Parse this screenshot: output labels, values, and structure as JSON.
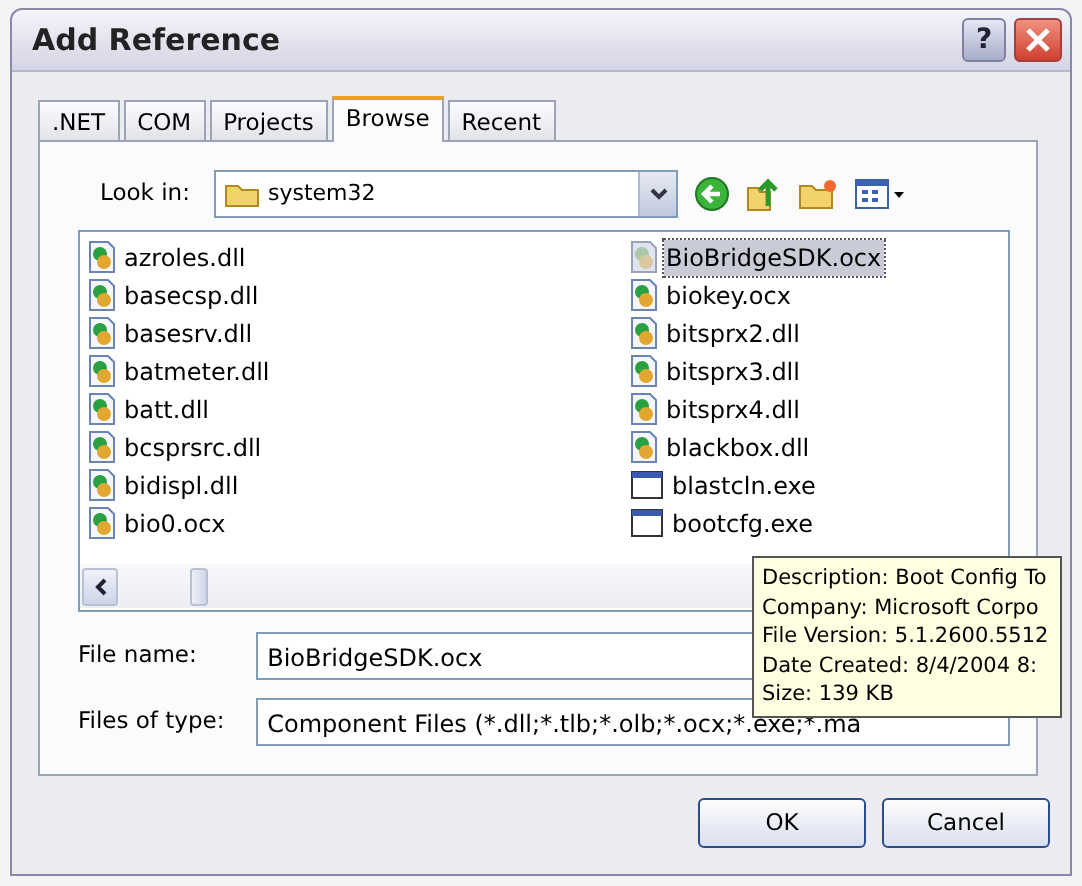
{
  "window": {
    "title": "Add Reference",
    "help": "?"
  },
  "tabs": [
    {
      "label": ".NET",
      "selected": false
    },
    {
      "label": "COM",
      "selected": false
    },
    {
      "label": "Projects",
      "selected": false
    },
    {
      "label": "Browse",
      "selected": true
    },
    {
      "label": "Recent",
      "selected": false
    }
  ],
  "look_in": {
    "label": "Look in:",
    "value": "system32"
  },
  "files": [
    {
      "name": "azroles.dll",
      "kind": "dll",
      "selected": false
    },
    {
      "name": "basecsp.dll",
      "kind": "dll",
      "selected": false
    },
    {
      "name": "basesrv.dll",
      "kind": "dll",
      "selected": false
    },
    {
      "name": "batmeter.dll",
      "kind": "dll",
      "selected": false
    },
    {
      "name": "batt.dll",
      "kind": "dll",
      "selected": false
    },
    {
      "name": "bcsprsrc.dll",
      "kind": "dll",
      "selected": false
    },
    {
      "name": "bidispl.dll",
      "kind": "dll",
      "selected": false
    },
    {
      "name": "bio0.ocx",
      "kind": "dll",
      "selected": false
    },
    {
      "name": "BioBridgeSDK.ocx",
      "kind": "dll",
      "selected": true
    },
    {
      "name": "biokey.ocx",
      "kind": "dll",
      "selected": false
    },
    {
      "name": "bitsprx2.dll",
      "kind": "dll",
      "selected": false
    },
    {
      "name": "bitsprx3.dll",
      "kind": "dll",
      "selected": false
    },
    {
      "name": "bitsprx4.dll",
      "kind": "dll",
      "selected": false
    },
    {
      "name": "blackbox.dll",
      "kind": "dll",
      "selected": false
    },
    {
      "name": "blastcln.exe",
      "kind": "exe",
      "selected": false
    },
    {
      "name": "bootcfg.exe",
      "kind": "exe",
      "selected": false
    }
  ],
  "file_name": {
    "label": "File name:",
    "value": "BioBridgeSDK.ocx"
  },
  "file_type": {
    "label": "Files of type:",
    "value": "Component Files (*.dll;*.tlb;*.olb;*.ocx;*.exe;*.ma"
  },
  "tooltip": {
    "lines": [
      "Description: Boot Config To",
      "Company: Microsoft Corpo",
      "File Version: 5.1.2600.5512",
      "Date Created: 8/4/2004 8:",
      "Size: 139 KB"
    ]
  },
  "buttons": [
    "OK",
    "Cancel"
  ]
}
